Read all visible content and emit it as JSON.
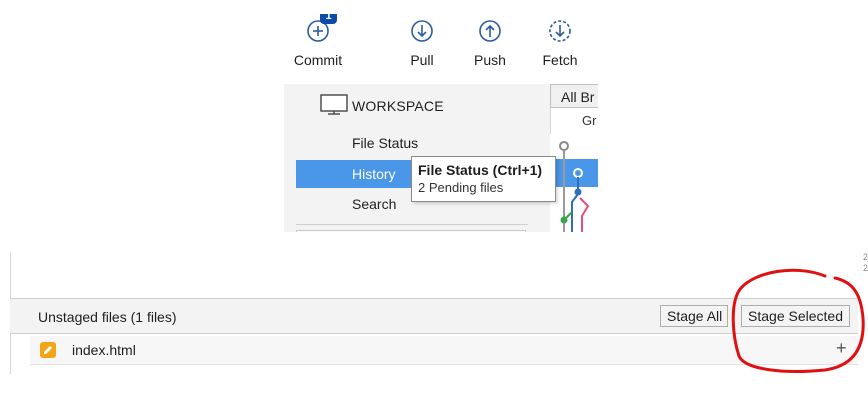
{
  "toolbar": {
    "commit": {
      "label": "Commit",
      "badge": "1",
      "icon": "plus-circle-icon"
    },
    "pull": {
      "label": "Pull",
      "icon": "arrow-down-circle-icon"
    },
    "push": {
      "label": "Push",
      "icon": "arrow-up-circle-icon"
    },
    "fetch": {
      "label": "Fetch",
      "icon": "dashed-arrow-down-circle-icon"
    }
  },
  "sidebar": {
    "workspace_label": "WORKSPACE",
    "items": [
      {
        "label": "File Status"
      },
      {
        "label": "History"
      },
      {
        "label": "Search"
      }
    ]
  },
  "branches": {
    "filter_label": "All Br",
    "graph_header": "Gr"
  },
  "tooltip": {
    "title": "File Status (Ctrl+1)",
    "subtitle": "2 Pending files"
  },
  "scroll_marks": [
    "2",
    "2"
  ],
  "unstaged": {
    "title": "Unstaged files  (1 files)",
    "stage_all": "Stage All",
    "stage_selected": "Stage Selected",
    "files": [
      {
        "name": "index.html",
        "status_icon": "pencil-modified-icon",
        "action": "+"
      }
    ]
  },
  "colors": {
    "accent": "#4a96e8",
    "badge": "#0b4aa8",
    "modified": "#f2a516",
    "annotation": "#e01010"
  }
}
